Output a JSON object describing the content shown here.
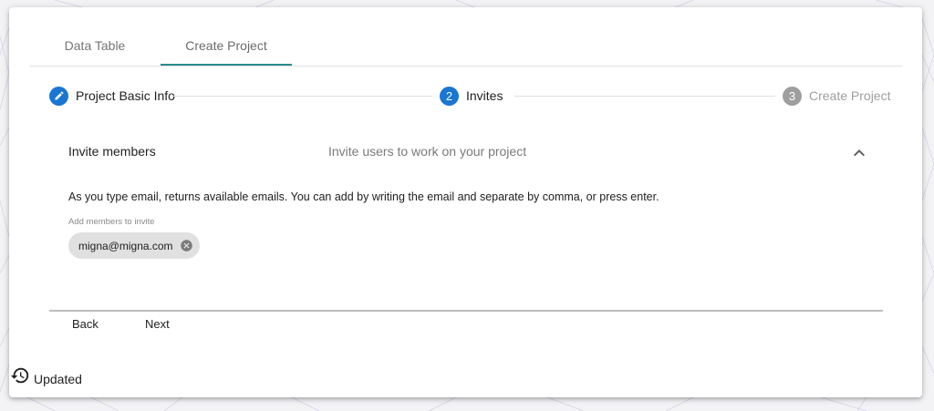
{
  "tabs": [
    {
      "label": "Data Table"
    },
    {
      "label": "Create Project"
    }
  ],
  "stepper": {
    "steps": [
      {
        "number": "",
        "label": "Project Basic Info",
        "icon": "pencil-icon",
        "state": "completed"
      },
      {
        "number": "2",
        "label": "Invites",
        "state": "active"
      },
      {
        "number": "3",
        "label": "Create Project",
        "state": "disabled"
      }
    ]
  },
  "panel": {
    "title": "Invite members",
    "subtitle": "Invite users to work on your project",
    "expand_icon": "chevron-up-icon"
  },
  "invite": {
    "instructions": "As you type email, returns available emails. You can add by writing the email and separate by comma, or press enter.",
    "field_label": "Add members to invite",
    "chips": [
      {
        "label": "migna@migna.com",
        "remove_icon": "cancel-icon"
      }
    ]
  },
  "actions": {
    "back_label": "Back",
    "next_label": "Next"
  },
  "status": {
    "label": "Updated",
    "icon": "history-icon"
  },
  "colors": {
    "primary": "#1976d2",
    "tab_indicator": "#2b8a8f",
    "disabled": "#9e9e9e",
    "chip_bg": "#e0e0e0"
  }
}
